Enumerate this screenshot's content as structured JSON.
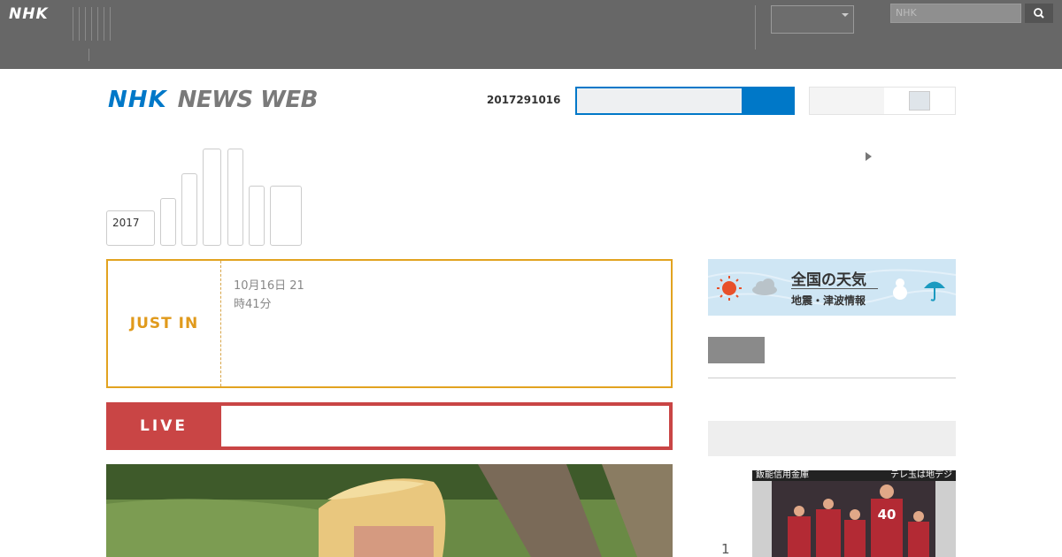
{
  "topbar": {
    "logo": "NHK",
    "nav": [
      {
        "lines": [
          "",
          ""
        ]
      },
      {
        "lines": [
          "",
          ""
        ]
      },
      {
        "lines": [
          ""
        ]
      },
      {
        "lines": [
          "",
          ""
        ]
      },
      {
        "lines": [
          "",
          ""
        ]
      },
      {
        "lines": [
          "",
          "",
          ""
        ]
      }
    ],
    "util1": [
      "",
      ""
    ],
    "util2": [
      ""
    ],
    "region": "",
    "search_placeholder": "NHK"
  },
  "header": {
    "brand_nhk": "NHK",
    "brand_newsweb": "NEWS WEB",
    "date_code": "2017291016",
    "toggle_label": ""
  },
  "tabs": [
    {
      "lines": [
        "",
        "2017"
      ]
    },
    {
      "lines": [
        ""
      ]
    },
    {
      "lines": [
        ""
      ]
    },
    {
      "lines": [
        ""
      ]
    },
    {
      "lines": [
        ""
      ]
    },
    {
      "lines": [
        ""
      ]
    },
    {
      "lines": [
        "",
        "",
        ""
      ]
    }
  ],
  "side_link": "",
  "just_in": {
    "label": "JUST IN",
    "headline": [
      "",
      "",
      ""
    ],
    "time": [
      "10月16日 21",
      "時41分"
    ]
  },
  "live": {
    "label": "LIVE",
    "text": ""
  },
  "weather": {
    "title": "全国の天気",
    "subtitle": "地震・津波情報"
  },
  "right_link": "",
  "ranking": {
    "heading": "",
    "rank1_number": "1",
    "thumb_caption_left": "飯能信用金庫",
    "thumb_caption_right": "テレ玉は地デジ"
  },
  "colors": {
    "topbar": "#676767",
    "brand_blue": "#0078c8",
    "justin_orange": "#e2a320",
    "live_red": "#c94545"
  }
}
